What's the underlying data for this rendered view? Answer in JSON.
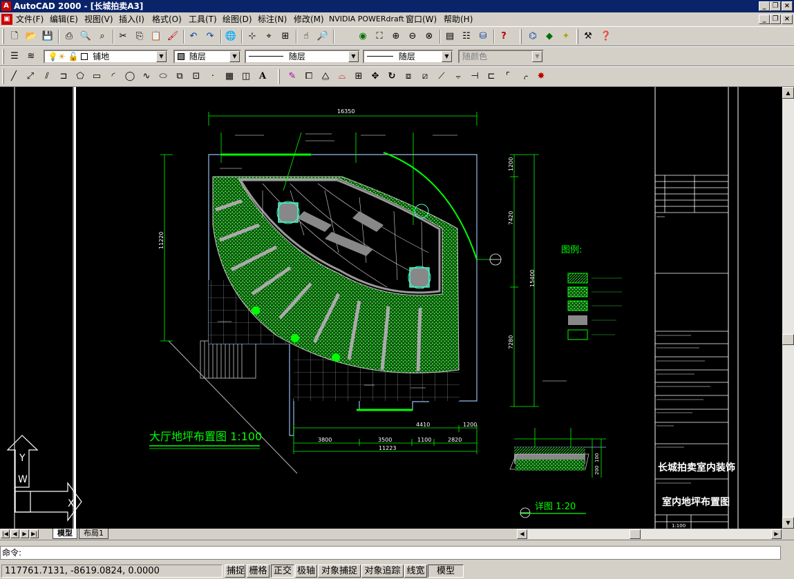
{
  "window": {
    "title": "AutoCAD 2000 - [长城拍卖A3]",
    "app_icon": "A",
    "doc_icon": "▣"
  },
  "menu": [
    "文件(F)",
    "编辑(E)",
    "视图(V)",
    "插入(I)",
    "格式(O)",
    "工具(T)",
    "绘图(D)",
    "标注(N)",
    "修改(M)",
    "NVIDIA POWERdraft",
    "窗口(W)",
    "帮助(H)"
  ],
  "layer_toolbar": {
    "layer_value": "铺地",
    "color_value": "随层",
    "linetype_value": "随层",
    "lineweight_value": "随层",
    "plotstyle_value": "随颜色"
  },
  "drawing": {
    "main_title": "大厅地坪布置图  1:100",
    "detail_title": "详图 1:20",
    "legend_title": "图例:",
    "dims": {
      "top_total": "16350",
      "left_height": "11220",
      "right_height": "15400",
      "right_top": "1200",
      "right_mid": "7420",
      "right_bottom": "7280",
      "bottom_a": "3800",
      "bottom_b": "3500",
      "bottom_c": "1100",
      "bottom_d": "2820",
      "bottom_total": "11223",
      "bottom_upper": "4410",
      "bottom_upper_right": "1200",
      "detail_a": "100",
      "detail_b": "200"
    },
    "title_block": {
      "project": "长城拍卖室内装饰",
      "sheet": "室内地坪布置图",
      "scale": "1:100"
    }
  },
  "tabs": [
    {
      "label": "模型",
      "active": true
    },
    {
      "label": "布局1",
      "active": false
    }
  ],
  "command": {
    "prompt": "命令:"
  },
  "status": {
    "coords": "117761.7131, -8619.0824, 0.0000",
    "buttons": [
      "捕捉",
      "栅格",
      "正交",
      "极轴",
      "对象捕捉",
      "对象追踪",
      "线宽",
      "模型"
    ]
  }
}
